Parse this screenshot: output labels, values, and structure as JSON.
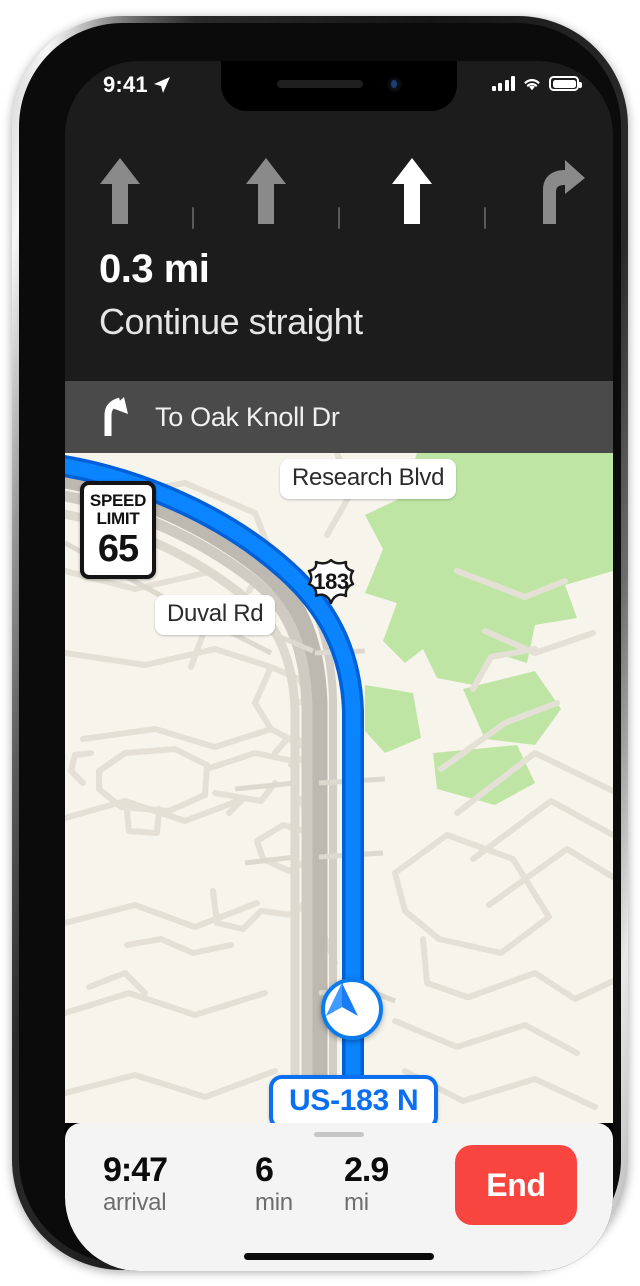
{
  "status_bar": {
    "time": "9:41",
    "location_icon": "location-arrow-icon",
    "cellular_icon": "cellular-bars-icon",
    "wifi_icon": "wifi-icon",
    "battery_icon": "battery-full-icon"
  },
  "nav_header": {
    "distance": "0.3 mi",
    "instruction": "Continue straight",
    "lanes": [
      {
        "icon": "lane-straight-arrow-icon",
        "active": false
      },
      {
        "icon": "lane-straight-arrow-icon",
        "active": false
      },
      {
        "icon": "lane-straight-arrow-icon",
        "active": true
      },
      {
        "icon": "lane-right-turn-arrow-icon",
        "active": false
      }
    ],
    "active_lane_color": "#ffffff",
    "inactive_lane_color": "#8a8a8a",
    "background_color": "#1c1c1c"
  },
  "secondary_bar": {
    "icon": "slight-right-arrow-icon",
    "text": "To Oak Knoll Dr",
    "background_color": "#4a4a4a"
  },
  "map": {
    "background_color": "#f7f4ec",
    "park_color": "#bfe5a4",
    "road_color": "#e2ded3",
    "highway_color": "#b8b4ab",
    "route_color": "#0a84ff",
    "route_outline_color": "#0060d8",
    "speed_limit": {
      "line1": "SPEED",
      "line2": "LIMIT",
      "value": "65"
    },
    "route_shield": {
      "number": "183",
      "type": "us-highway-shield"
    },
    "labels": [
      {
        "name": "Research Blvd"
      },
      {
        "name": "Duval Rd"
      }
    ],
    "current_road_badge": "US-183 N",
    "current_road_badge_color": "#0a6ff0",
    "location_puck": "navigation-arrow-puck-icon"
  },
  "trip_bar": {
    "grabber": "drag-handle",
    "stats": [
      {
        "value": "9:47",
        "label": "arrival"
      },
      {
        "value": "6",
        "label": "min"
      },
      {
        "value": "2.9",
        "label": "mi"
      }
    ],
    "end_button": "End",
    "end_button_color": "#f8453f",
    "background_color": "#f4f4f4"
  }
}
